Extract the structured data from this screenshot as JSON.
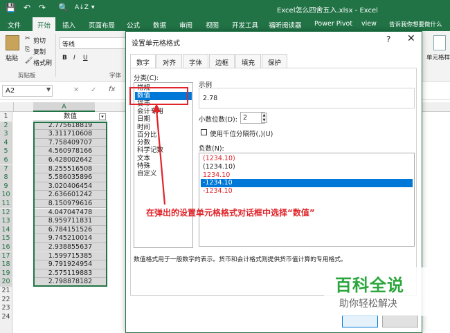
{
  "app": {
    "title": "Excel怎么四舍五入.xlsx - Excel",
    "quick_access": [
      "💾",
      "↶",
      "↷",
      "🔍",
      "A↓Z",
      "▾"
    ]
  },
  "ribbon_tabs": [
    "文件",
    "开始",
    "插入",
    "页面布局",
    "公式",
    "数据",
    "审阅",
    "视图",
    "开发工具",
    "福昕阅读器",
    "Power Pivot",
    "view",
    "告诉我你想要做什么"
  ],
  "ribbon": {
    "paste": "粘贴",
    "cut": "剪切",
    "copy": "复制",
    "format_painter": "格式刷",
    "clipboard": "剪贴板",
    "font_name": "等线",
    "font_group": "字体",
    "bold": "B",
    "italic": "I",
    "underline": "U",
    "cell_style": "单元格样"
  },
  "formula_bar": {
    "name_box": "A2",
    "fx": "fx"
  },
  "sheet": {
    "column_header": "A",
    "header_cell": "数值",
    "rows": [
      "1",
      "2",
      "3",
      "4",
      "5",
      "6",
      "7",
      "8",
      "9",
      "10",
      "11",
      "12",
      "13",
      "14",
      "15",
      "16",
      "17",
      "18",
      "19",
      "20",
      "21",
      "22",
      "23",
      "24"
    ],
    "values": [
      "2.775618819",
      "3.311710608",
      "7.758409707",
      "4.560978166",
      "6.428002642",
      "8.255516508",
      "5.586035896",
      "3.020406454",
      "2.636601242",
      "8.150979616",
      "4.047047478",
      "8.959711831",
      "6.784151526",
      "9.745210014",
      "2.938855637",
      "1.599715385",
      "9.791924954",
      "2.575119883",
      "2.798878182"
    ]
  },
  "dialog": {
    "title": "设置单元格格式",
    "help": "?",
    "close": "✕",
    "tabs": [
      "数字",
      "对齐",
      "字体",
      "边框",
      "填充",
      "保护"
    ],
    "category_label": "分类(C):",
    "categories": [
      "常规",
      "数值",
      "货币",
      "会计专用",
      "日期",
      "时间",
      "百分比",
      "分数",
      "科学记数",
      "文本",
      "特殊",
      "自定义"
    ],
    "selected_category": 1,
    "sample_label": "示例",
    "sample_value": "2.78",
    "decimal_label": "小数位数(D):",
    "decimal_value": "2",
    "thousands_label": "使用千位分隔符(,)(U)",
    "negative_label": "负数(N):",
    "negatives": [
      {
        "text": "(1234.10)",
        "color": "#e0242a"
      },
      {
        "text": "(1234.10)",
        "color": "#222222"
      },
      {
        "text": "1234.10",
        "color": "#e0242a"
      },
      {
        "text": "-1234.10",
        "color": "#ffffff"
      },
      {
        "text": "-1234.10",
        "color": "#e0242a"
      }
    ],
    "selected_negative": 3,
    "description": "数值格式用于一般数字的表示。货币和会计格式则提供货币值计算的专用格式。"
  },
  "annotation": "在弹出的设置单元格格式对话框中选择“数值”",
  "watermark": {
    "line1": "百科全说",
    "line2": "助你轻松解决"
  },
  "colors": {
    "excel_green": "#217346",
    "selection_blue": "#0078d7",
    "annotation_red": "#e0242a"
  }
}
